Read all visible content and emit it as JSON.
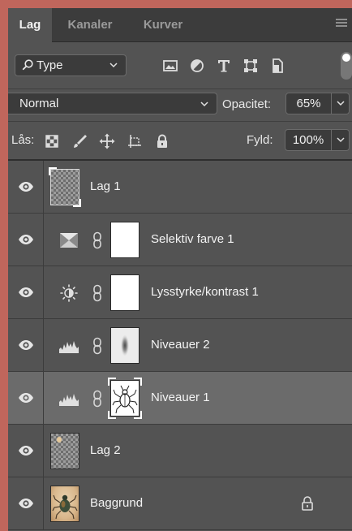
{
  "tabs": [
    {
      "label": "Lag",
      "active": true
    },
    {
      "label": "Kanaler",
      "active": false
    },
    {
      "label": "Kurver",
      "active": false
    }
  ],
  "filter": {
    "selected": "Type"
  },
  "blend": {
    "mode": "Normal",
    "opacity_label": "Opacitet:",
    "opacity_value": "65%"
  },
  "lock": {
    "label": "Lås:",
    "fill_label": "Fyld:",
    "fill_value": "100%"
  },
  "layers": [
    {
      "name": "Lag 1",
      "kind": "pixel",
      "visible": true,
      "selected": false
    },
    {
      "name": "Selektiv farve 1",
      "kind": "adjustment",
      "adjustment_icon": "selective-color-icon",
      "visible": true,
      "selected": false
    },
    {
      "name": "Lysstyrke/kontrast 1",
      "kind": "adjustment",
      "adjustment_icon": "brightness-contrast-icon",
      "visible": true,
      "selected": false
    },
    {
      "name": "Niveauer 2",
      "kind": "adjustment",
      "adjustment_icon": "levels-icon",
      "visible": true,
      "selected": false
    },
    {
      "name": "Niveauer 1",
      "kind": "adjustment",
      "adjustment_icon": "levels-icon",
      "visible": true,
      "selected": true
    },
    {
      "name": "Lag 2",
      "kind": "pixel",
      "visible": true,
      "selected": false
    },
    {
      "name": "Baggrund",
      "kind": "background",
      "visible": true,
      "selected": false,
      "locked": true
    }
  ],
  "colors": {
    "panel_bg": "#535353",
    "selected_row": "#6b6b6b",
    "frame": "#c0665c"
  }
}
